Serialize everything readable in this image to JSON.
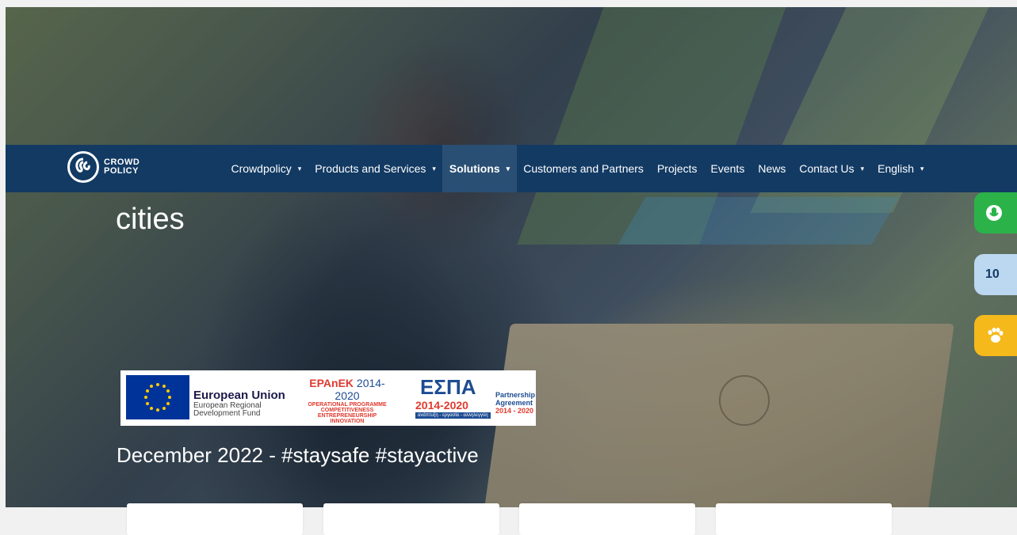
{
  "navbar": {
    "logo_line1": "CROWD",
    "logo_line2": "POLICY",
    "items": [
      {
        "label": "Crowdpolicy",
        "has_caret": true
      },
      {
        "label": "Products and Services",
        "has_caret": true
      },
      {
        "label": "Solutions",
        "has_caret": true,
        "active": true
      },
      {
        "label": "Customers and Partners",
        "has_caret": false
      },
      {
        "label": "Projects",
        "has_caret": false
      },
      {
        "label": "Events",
        "has_caret": false
      },
      {
        "label": "News",
        "has_caret": false
      },
      {
        "label": "Contact Us",
        "has_caret": true
      },
      {
        "label": "English",
        "has_caret": true
      }
    ],
    "caret": "▾"
  },
  "hero": {
    "heading": "cities",
    "headline": "December 2022 - #staysafe #stayactive"
  },
  "banner": {
    "eu_title": "European Union",
    "eu_sub1": "European Regional",
    "eu_sub2": "Development Fund",
    "epa_title": "EPAnEK",
    "epa_years": "2014-2020",
    "epa_line1": "OPERATIONAL PROGRAMME",
    "epa_line2": "COMPETITIVENESS",
    "epa_line3": "ENTREPRENEURSHIP",
    "epa_line4": "INNOVATION",
    "espa_title": "ΕΣΠΑ",
    "espa_years": "2014-2020",
    "espa_tag": "ανάπτυξη - εργασία - αλληλεγγύη",
    "partnership1": "Partnership",
    "partnership2": "Agreement",
    "partnership3": "2014 - 2020"
  },
  "side_buttons": {
    "blue_label": "10"
  },
  "colors": {
    "navbar": "#123a63",
    "active_item": "#2a4f74",
    "green": "#2bb34a",
    "light_blue": "#bcd7f0",
    "yellow": "#f5b91b"
  }
}
